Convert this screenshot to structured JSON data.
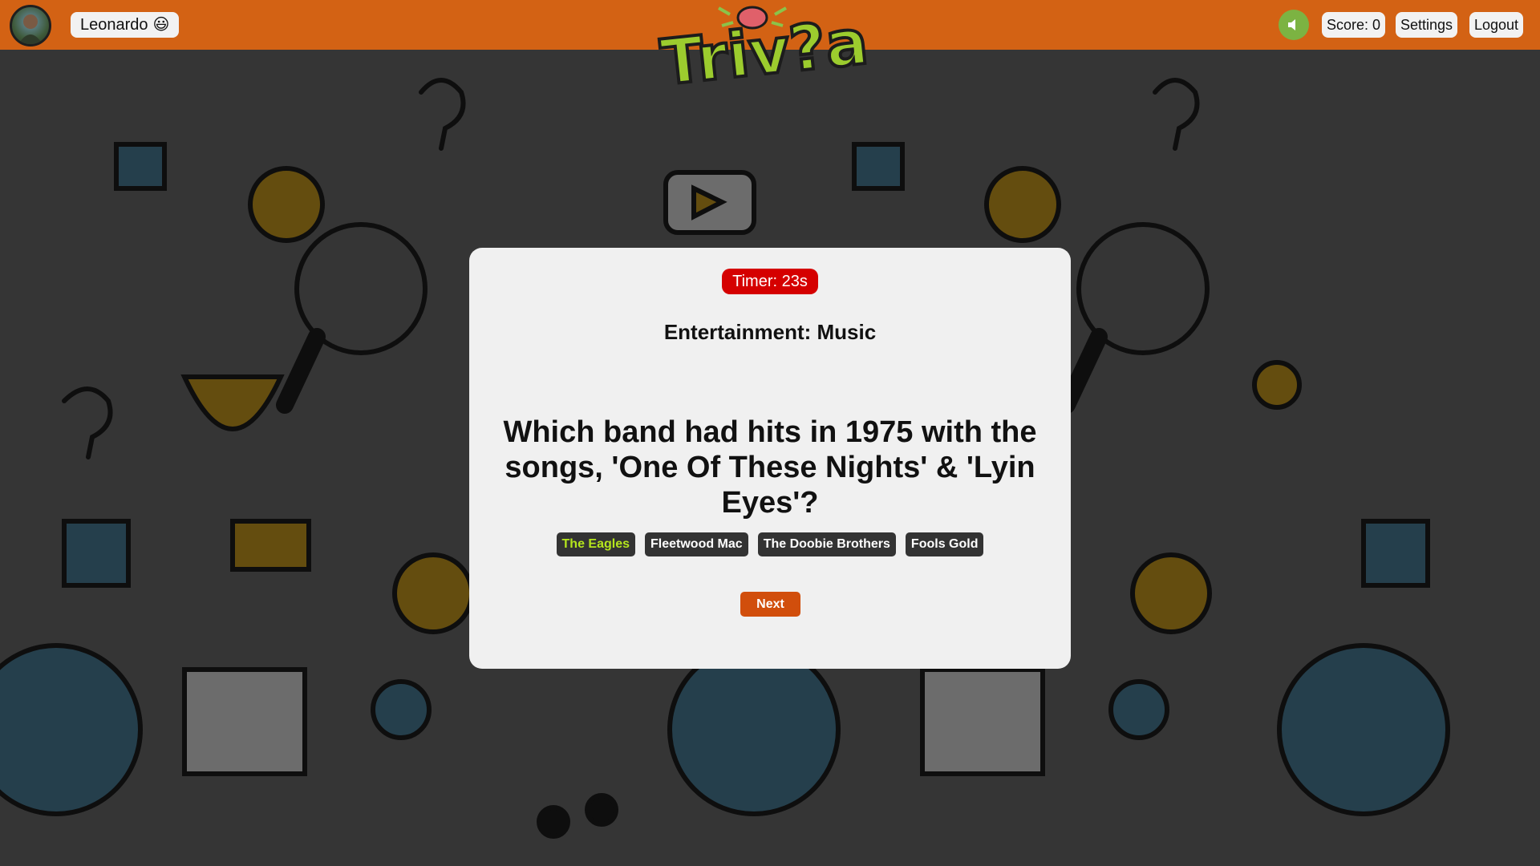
{
  "header": {
    "username": "Leonardo",
    "user_emoji": "😃",
    "logo_text": "Triv?a",
    "score_label": "Score: 0",
    "settings_label": "Settings",
    "logout_label": "Logout",
    "sound_icon": "speaker-icon"
  },
  "quiz": {
    "timer_label": "Timer: 23s",
    "category": "Entertainment: Music",
    "question": "Which band had hits in 1975 with the songs, 'One Of These Nights' & 'Lyin Eyes'?",
    "answers": [
      {
        "label": "The Eagles",
        "correct": true
      },
      {
        "label": "Fleetwood Mac",
        "correct": false
      },
      {
        "label": "The Doobie Brothers",
        "correct": false
      },
      {
        "label": "Fools Gold",
        "correct": false
      }
    ],
    "next_label": "Next"
  },
  "colors": {
    "header_bg": "#d36214",
    "timer_bg": "#d50000",
    "correct_text": "#b5e61d",
    "next_bg": "#d14e0c",
    "sound_bg": "#7cb342",
    "logo_green": "#9ccc2e"
  }
}
